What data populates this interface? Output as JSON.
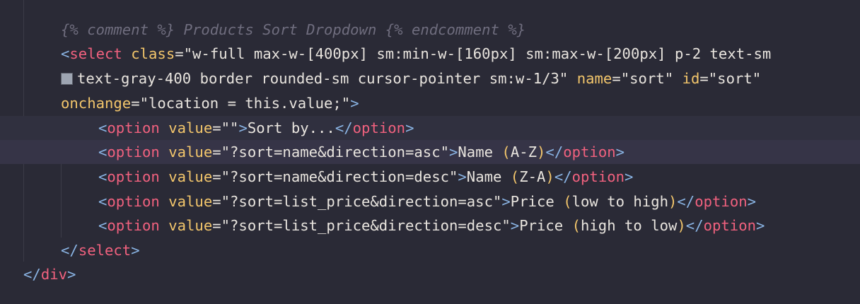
{
  "editor": {
    "colors": {
      "background": "#2a2a36",
      "tag": "#f0617e",
      "attribute": "#f2c56b",
      "punctuation": "#8ab4e4",
      "comment": "#6f6d7e",
      "text": "#e8e4de",
      "color_swatch": "#9ea5b2"
    },
    "lines": [
      {
        "comment": "{% comment %} Products Sort Dropdown {% endcomment %}"
      },
      {
        "open": "<",
        "tag": "select",
        "attr": "class",
        "eq": "=",
        "value": "\"w-full max-w-[400px] sm:min-w-[160px] sm:max-w-[200px] p-2 text-sm"
      },
      {
        "swatch_icon": "color-swatch-icon",
        "value": "text-gray-400 border rounded-sm cursor-pointer sm:w-1/3\"",
        "attr_name": "name",
        "eq1": "=",
        "name_value": "\"sort\"",
        "attr_id": "id",
        "eq2": "=",
        "id_value": "\"sort\""
      },
      {
        "attr": "onchange",
        "eq": "=",
        "value": "\"location = this.value;\"",
        "close": ">"
      },
      {
        "open": "<",
        "tag": "option",
        "attr": "value",
        "eq": "=",
        "value": "\"\"",
        "close": ">",
        "text": "Sort by...",
        "end_open": "</",
        "end_tag": "option",
        "end_close": ">"
      },
      {
        "open": "<",
        "tag": "option",
        "attr": "value",
        "eq": "=",
        "value": "\"?sort=name&direction=asc\"",
        "close": ">",
        "text": "Name ",
        "paren_open": "(",
        "inner": "A-Z",
        "paren_close": ")",
        "end_open": "</",
        "end_tag": "option",
        "end_close": ">"
      },
      {
        "open": "<",
        "tag": "option",
        "attr": "value",
        "eq": "=",
        "value": "\"?sort=name&direction=desc\"",
        "close": ">",
        "text": "Name ",
        "paren_open": "(",
        "inner": "Z-A",
        "paren_close": ")",
        "end_open": "</",
        "end_tag": "option",
        "end_close": ">"
      },
      {
        "open": "<",
        "tag": "option",
        "attr": "value",
        "eq": "=",
        "value": "\"?sort=list_price&direction=asc\"",
        "close": ">",
        "text": "Price ",
        "paren_open": "(",
        "inner": "low to high",
        "paren_close": ")",
        "end_open": "</",
        "end_tag": "option",
        "end_close": ">"
      },
      {
        "open": "<",
        "tag": "option",
        "attr": "value",
        "eq": "=",
        "value": "\"?sort=list_price&direction=desc\"",
        "close": ">",
        "text": "Price ",
        "paren_open": "(",
        "inner": "high to low",
        "paren_close": ")",
        "end_open": "</",
        "end_tag": "option",
        "end_close": ">"
      },
      {
        "end_open": "</",
        "end_tag": "select",
        "end_close": ">"
      },
      {
        "end_open": "</",
        "end_tag": "div",
        "end_close": ">"
      }
    ]
  }
}
